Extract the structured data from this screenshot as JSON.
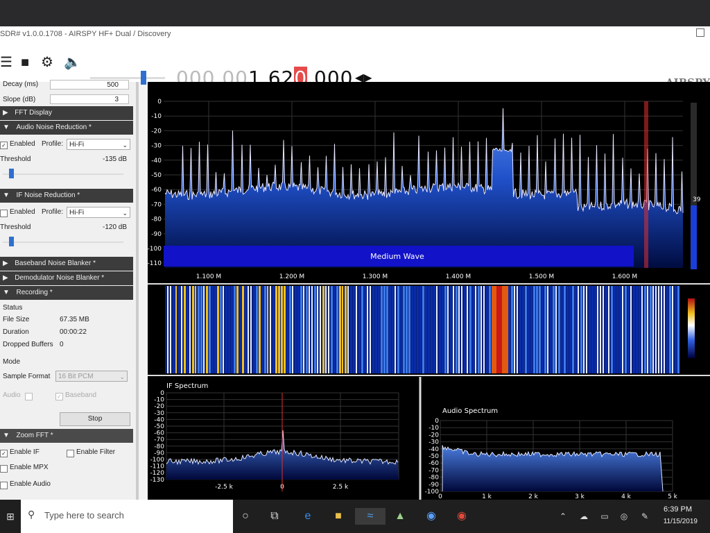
{
  "window": {
    "title": "SDR# v1.0.0.1708 - AIRSPY HF+ Dual / Discovery",
    "brand": "AIRSPY"
  },
  "toolbar": {
    "freq_dim": "000.00",
    "freq_main_a": "1.62",
    "freq_highlight": "0",
    "freq_main_b": ".000"
  },
  "sidebar": {
    "decay_label": "Decay (ms)",
    "decay_value": "500",
    "slope_label": "Slope (dB)",
    "slope_value": "3",
    "fft_display": "FFT Display",
    "anr": {
      "header": "Audio Noise Reduction *",
      "enabled_label": "Enabled",
      "enabled": true,
      "profile_label": "Profile:",
      "profile": "Hi-Fi",
      "threshold_label": "Threshold",
      "threshold_value": "-135 dB",
      "threshold_level": 0.05
    },
    "ifnr": {
      "header": "IF Noise Reduction *",
      "enabled_label": "Enabled",
      "enabled": false,
      "profile_label": "Profile:",
      "profile": "Hi-Fi",
      "threshold_label": "Threshold",
      "threshold_value": "-120 dB",
      "threshold_level": 0.05
    },
    "baseband_nb": "Baseband Noise Blanker *",
    "demod_nb": "Demodulator Noise Blanker *",
    "recording": {
      "header": "Recording *",
      "status_label": "Status",
      "file_size_label": "File Size",
      "file_size": "67.35 MB",
      "duration_label": "Duration",
      "duration": "00:00:22",
      "dropped_label": "Dropped Buffers",
      "dropped": "0",
      "mode_label": "Mode",
      "sample_format_label": "Sample Format",
      "sample_format": "16 Bit PCM",
      "audio_label": "Audio",
      "baseband_label": "Baseband",
      "stop_label": "Stop"
    },
    "zoom": {
      "header": "Zoom FFT *",
      "enable_if": "Enable IF",
      "enable_filter": "Enable Filter",
      "enable_mpx": "Enable MPX",
      "enable_audio": "Enable Audio"
    }
  },
  "spectrum": {
    "band_label": "Medium Wave",
    "y_ticks": [
      "0",
      "-10",
      "-20",
      "-30",
      "-40",
      "-50",
      "-60",
      "-70",
      "-80",
      "-90",
      "-100",
      "-110"
    ],
    "x_ticks": [
      "1.100 M",
      "1.200 M",
      "1.300 M",
      "1.400 M",
      "1.500 M",
      "1.600 M"
    ],
    "gain_value": "39"
  },
  "if_spectrum": {
    "title": "IF Spectrum",
    "y_ticks": [
      "0",
      "-10",
      "-20",
      "-30",
      "-40",
      "-50",
      "-60",
      "-70",
      "-80",
      "-90",
      "-100",
      "-110",
      "-120",
      "-130"
    ],
    "x_ticks": [
      "-2.5 k",
      "0",
      "2.5 k"
    ]
  },
  "audio_spectrum": {
    "title": "Audio Spectrum",
    "y_ticks": [
      "0",
      "-10",
      "-20",
      "-30",
      "-40",
      "-50",
      "-60",
      "-70",
      "-80",
      "-90",
      "-100"
    ],
    "x_ticks": [
      "0",
      "1 k",
      "2 k",
      "3 k",
      "4 k",
      "5 k"
    ]
  },
  "taskbar": {
    "search_placeholder": "Type here to search",
    "time": "6:39 PM",
    "date": "11/15/2019"
  },
  "colors": {
    "spectrum_fill": "#1f5fd6",
    "band_bar": "#1212c8",
    "cursor": "#e03030"
  }
}
